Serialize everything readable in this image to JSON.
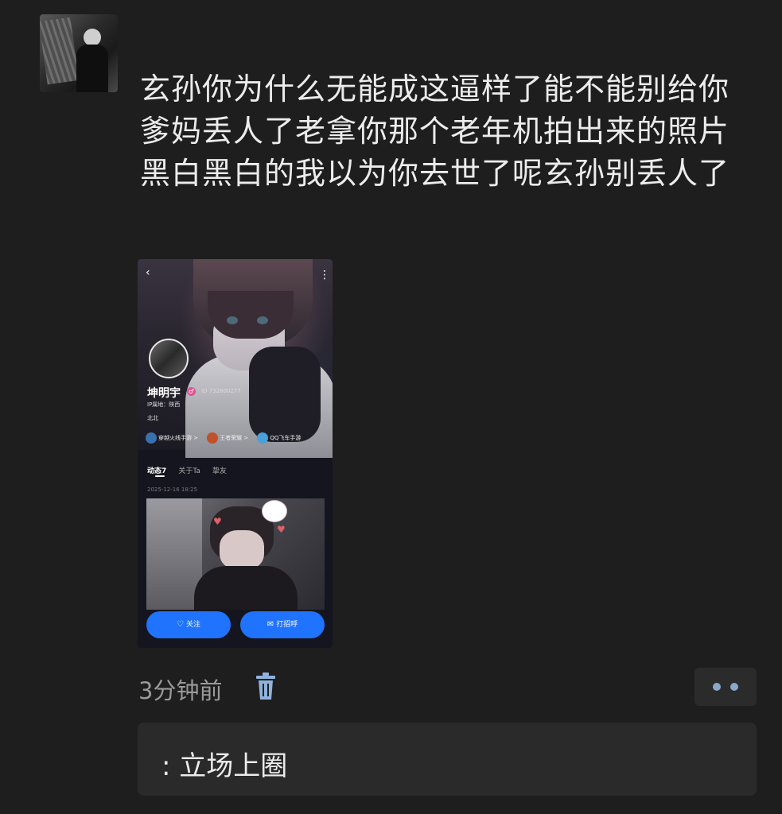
{
  "post": {
    "text": "玄孙你为什么无能成这逼样了能不能别给你爹妈丢人了老拿你那个老年机拍出来的照片黑白黑白的我以为你去世了呢玄孙别丢人了",
    "time": "3分钟前"
  },
  "screenshot": {
    "profile": {
      "name": "坤明宇",
      "gender_symbol": "♂",
      "id": "ID 732800277",
      "ip": "IP属地：陕西",
      "bio": "北北"
    },
    "games": [
      {
        "label": "穿越火线手游 >",
        "color": "#3a6fb0"
      },
      {
        "label": "王者荣耀 >",
        "color": "#c0502a"
      },
      {
        "label": "QQ飞车手游",
        "color": "#4aa0d8"
      }
    ],
    "tabs": [
      "动态7",
      "关于Ta",
      "挚友"
    ],
    "post_date": "2025-12-16  18:25",
    "buttons": {
      "follow": "关注",
      "greet": "打招呼"
    }
  },
  "reply": {
    "text": ": 立场上圈"
  },
  "colors": {
    "background": "#1e1e1e",
    "accent_blue": "#1f73ff",
    "reply_box": "#2a2a2a"
  }
}
